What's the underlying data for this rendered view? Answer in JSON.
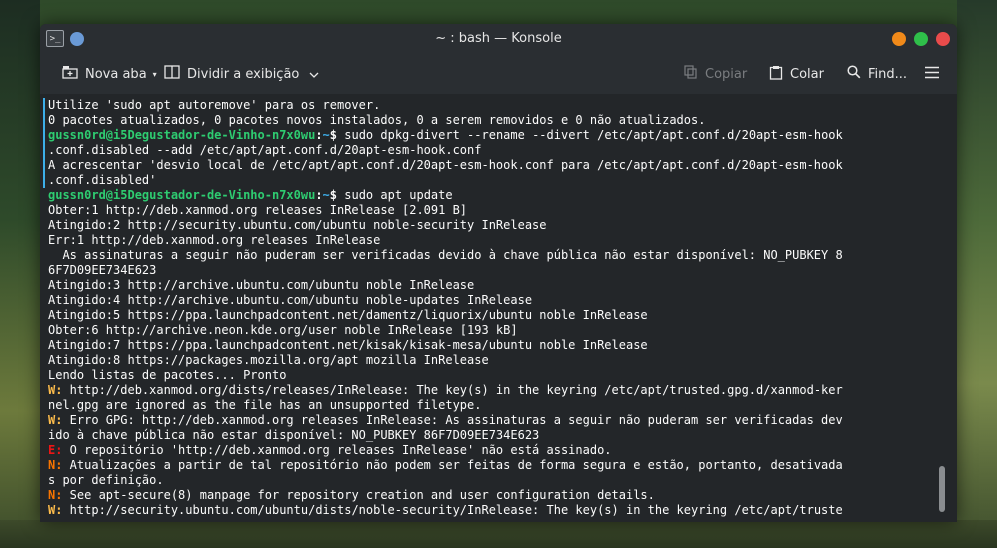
{
  "window": {
    "title": "~ : bash — Konsole",
    "app_icon": "terminal-icon",
    "accent": "#3daee9",
    "buttons": {
      "minimize": "#f08a1a",
      "maximize": "#2fbf4a",
      "close": "#e94b4b"
    }
  },
  "toolbar": {
    "new_tab": "Nova aba",
    "split_view": "Dividir a exibição",
    "copy": "Copiar",
    "paste": "Colar",
    "find": "Find..."
  },
  "terminal": {
    "user_host": "gussn0rd@i5Degustador-de-Vinho-n7x0wu",
    "sep": ":",
    "path": "~",
    "dollar": "$",
    "lines": [
      {
        "text": "Utilize 'sudo apt autoremove' para os remover."
      },
      {
        "text": "0 pacotes atualizados, 0 pacotes novos instalados, 0 a serem removidos e 0 não atualizados."
      },
      {
        "prompt": true,
        "text": " sudo dpkg-divert --rename --divert /etc/apt/apt.conf.d/20apt-esm-hook"
      },
      {
        "text": ".conf.disabled --add /etc/apt/apt.conf.d/20apt-esm-hook.conf"
      },
      {
        "text": "A acrescentar 'desvio local de /etc/apt/apt.conf.d/20apt-esm-hook.conf para /etc/apt/apt.conf.d/20apt-esm-hook"
      },
      {
        "text": ".conf.disabled'"
      },
      {
        "prompt": true,
        "text": " sudo apt update"
      },
      {
        "text": "Obter:1 http://deb.xanmod.org releases InRelease [2.091 B]"
      },
      {
        "text": "Atingido:2 http://security.ubuntu.com/ubuntu noble-security InRelease"
      },
      {
        "text": "Err:1 http://deb.xanmod.org releases InRelease"
      },
      {
        "text": "  As assinaturas a seguir não puderam ser verificadas devido à chave pública não estar disponível: NO_PUBKEY 8"
      },
      {
        "text": "6F7D09EE734E623"
      },
      {
        "text": "Atingido:3 http://archive.ubuntu.com/ubuntu noble InRelease"
      },
      {
        "text": "Atingido:4 http://archive.ubuntu.com/ubuntu noble-updates InRelease"
      },
      {
        "text": "Atingido:5 https://ppa.launchpadcontent.net/damentz/liquorix/ubuntu noble InRelease"
      },
      {
        "text": "Obter:6 http://archive.neon.kde.org/user noble InRelease [193 kB]"
      },
      {
        "text": "Atingido:7 https://ppa.launchpadcontent.net/kisak/kisak-mesa/ubuntu noble InRelease"
      },
      {
        "text": "Atingido:8 https://packages.mozilla.org/apt mozilla InRelease"
      },
      {
        "text": "Lendo listas de pacotes... Pronto"
      },
      {
        "tag": "W:",
        "kind": "W",
        "text": " http://deb.xanmod.org/dists/releases/InRelease: The key(s) in the keyring /etc/apt/trusted.gpg.d/xanmod-ker"
      },
      {
        "text": "nel.gpg are ignored as the file has an unsupported filetype."
      },
      {
        "tag": "W:",
        "kind": "W",
        "text": " Erro GPG: http://deb.xanmod.org releases InRelease: As assinaturas a seguir não puderam ser verificadas dev"
      },
      {
        "text": "ido à chave pública não estar disponível: NO_PUBKEY 86F7D09EE734E623"
      },
      {
        "tag": "E:",
        "kind": "E",
        "text": " O repositório 'http://deb.xanmod.org releases InRelease' não está assinado."
      },
      {
        "tag": "N:",
        "kind": "N",
        "text": " Atualizações a partir de tal repositório não podem ser feitas de forma segura e estão, portanto, desativada"
      },
      {
        "text": "s por definição."
      },
      {
        "tag": "N:",
        "kind": "N",
        "text": " See apt-secure(8) manpage for repository creation and user configuration details."
      },
      {
        "tag": "W:",
        "kind": "W",
        "text": " http://security.ubuntu.com/ubuntu/dists/noble-security/InRelease: The key(s) in the keyring /etc/apt/truste"
      }
    ]
  }
}
